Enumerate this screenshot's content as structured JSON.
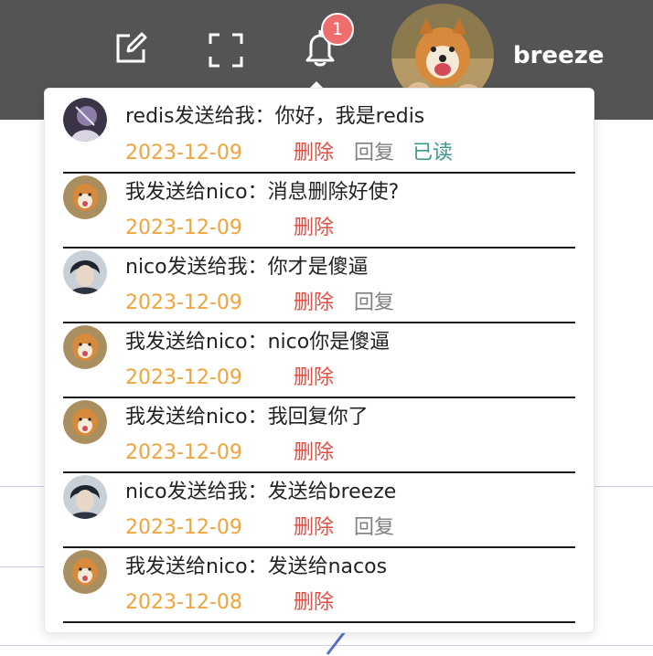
{
  "header": {
    "username": "breeze",
    "notification_count": "1",
    "icons": [
      "edit-icon",
      "fullscreen-icon",
      "bell-icon"
    ]
  },
  "messages": [
    {
      "text": "redis发送给我：你好，我是redis",
      "date": "2023-12-09",
      "avatar": "dark-purple-avatar",
      "delete": "删除",
      "reply": "回复",
      "read": "已读"
    },
    {
      "text": "我发送给nico：消息删除好使?",
      "date": "2023-12-09",
      "avatar": "dog-avatar",
      "delete": "删除"
    },
    {
      "text": "nico发送给我：你才是傻逼",
      "date": "2023-12-09",
      "avatar": "anime-boy-avatar",
      "delete": "删除",
      "reply": "回复"
    },
    {
      "text": "我发送给nico：nico你是傻逼",
      "date": "2023-12-09",
      "avatar": "dog-avatar",
      "delete": "删除"
    },
    {
      "text": "我发送给nico：我回复你了",
      "date": "2023-12-09",
      "avatar": "dog-avatar",
      "delete": "删除"
    },
    {
      "text": "nico发送给我：发送给breeze",
      "date": "2023-12-09",
      "avatar": "anime-boy-avatar",
      "delete": "删除",
      "reply": "回复"
    },
    {
      "text": "我发送给nico：发送给nacos",
      "date": "2023-12-08",
      "avatar": "dog-avatar",
      "delete": "删除"
    }
  ],
  "colors": {
    "header_bg": "#545454",
    "date": "#f0a43c",
    "delete": "#e84a3e",
    "reply": "#808080",
    "read": "#3d9590",
    "badge": "#ee6e6e"
  }
}
